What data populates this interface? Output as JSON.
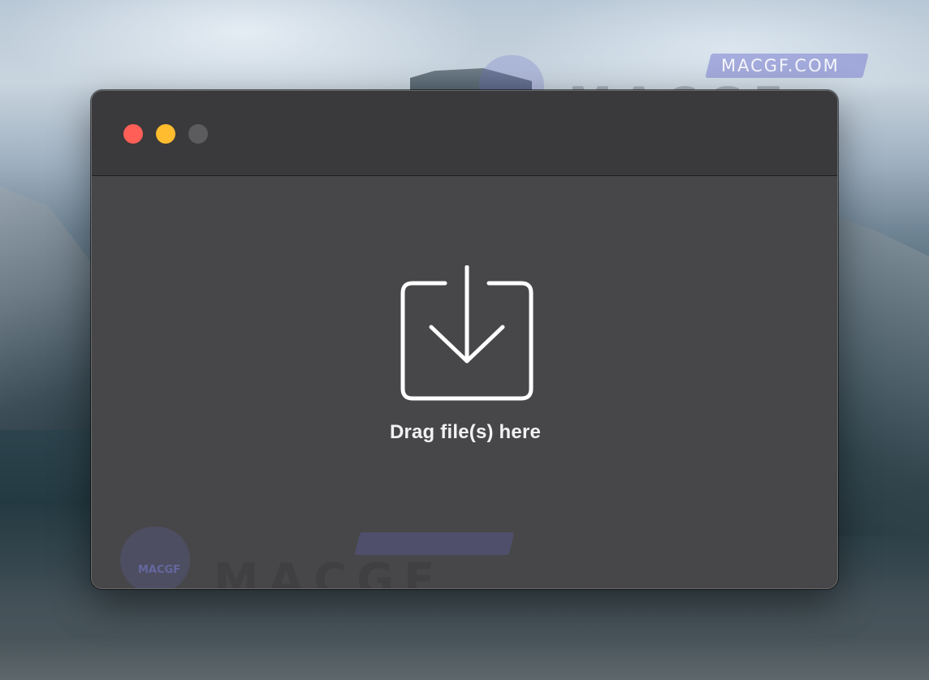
{
  "watermark": {
    "site_text": "MACGF.COM",
    "brand_text": "MACGF",
    "logo_text": "MACGF"
  },
  "window": {
    "controls": {
      "close": "close-button",
      "minimize": "minimize-button",
      "zoom": "zoom-button"
    },
    "drop_zone": {
      "icon": "download-tray-icon",
      "label": "Drag file(s) here"
    }
  },
  "colors": {
    "close": "#ff5f57",
    "minimize": "#febc2e",
    "zoom_inactive": "#5c5b5e",
    "window_bg": "#474648",
    "titlebar_bg": "#3a393b",
    "label": "#f2f2f3"
  }
}
